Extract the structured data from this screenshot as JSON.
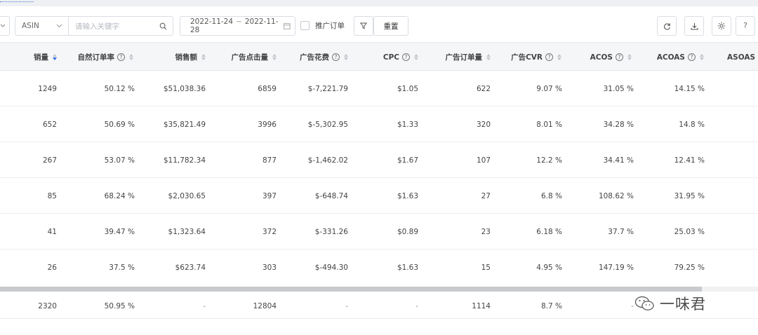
{
  "toolbar": {
    "asin_select": "ASIN",
    "keyword_placeholder": "请输入关键字",
    "date_start": "2022-11-24",
    "date_sep": "~",
    "date_end": "2022-11-28",
    "promo_orders_label": "推广订单",
    "reset_label": "重置",
    "help_label": "?"
  },
  "columns": [
    {
      "key": "sales_qty",
      "label": "销量",
      "help": false,
      "sort_active": "desc"
    },
    {
      "key": "natural_order_rate",
      "label": "自然订单率",
      "help": true
    },
    {
      "key": "sales_amount",
      "label": "销售额",
      "help": false
    },
    {
      "key": "ad_clicks",
      "label": "广告点击量",
      "help": false
    },
    {
      "key": "ad_spend",
      "label": "广告花费",
      "help": true
    },
    {
      "key": "cpc",
      "label": "CPC",
      "help": true
    },
    {
      "key": "ad_orders",
      "label": "广告订单量",
      "help": false
    },
    {
      "key": "ad_cvr",
      "label": "广告CVR",
      "help": true
    },
    {
      "key": "acos",
      "label": "ACOS",
      "help": true
    },
    {
      "key": "acoas",
      "label": "ACOAS",
      "help": true
    },
    {
      "key": "asoas",
      "label": "ASOAS",
      "help": false
    }
  ],
  "rows": [
    [
      "1249",
      "50.12 %",
      "$51,038.36",
      "6859",
      "$-7,221.79",
      "$1.05",
      "622",
      "9.07 %",
      "31.05 %",
      "14.15 %"
    ],
    [
      "652",
      "50.69 %",
      "$35,821.49",
      "3996",
      "$-5,302.95",
      "$1.33",
      "320",
      "8.01 %",
      "34.28 %",
      "14.8 %"
    ],
    [
      "267",
      "53.07 %",
      "$11,782.34",
      "877",
      "$-1,462.02",
      "$1.67",
      "107",
      "12.2 %",
      "34.41 %",
      "12.41 %"
    ],
    [
      "85",
      "68.24 %",
      "$2,030.65",
      "397",
      "$-648.74",
      "$1.63",
      "27",
      "6.8 %",
      "108.62 %",
      "31.95 %"
    ],
    [
      "41",
      "39.47 %",
      "$1,323.64",
      "372",
      "$-331.26",
      "$0.89",
      "23",
      "6.18 %",
      "37.7 %",
      "25.03 %"
    ],
    [
      "26",
      "37.5 %",
      "$623.74",
      "303",
      "$-494.30",
      "$1.63",
      "15",
      "4.95 %",
      "147.19 %",
      "79.25 %"
    ]
  ],
  "summary": [
    "2320",
    "50.95 %",
    "-",
    "12804",
    "-",
    "-",
    "1114",
    "8.7 %",
    "-",
    ""
  ],
  "watermark": "一味君"
}
